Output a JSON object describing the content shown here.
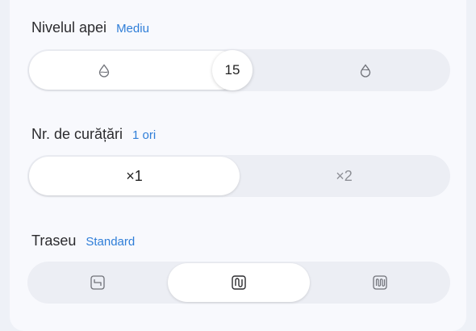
{
  "water_level": {
    "title": "Nivelul apei",
    "value": "Mediu",
    "slider_value": "15",
    "min_icon": "small-water-drop-icon",
    "max_icon": "large-water-drop-icon"
  },
  "cleaning_count": {
    "title": "Nr. de curățări",
    "value": "1 ori",
    "options": [
      "×1",
      "×2"
    ],
    "selected_index": 0
  },
  "route": {
    "title": "Traseu",
    "value": "Standard",
    "options": [
      "quick-route-icon",
      "standard-route-icon",
      "deep-route-icon"
    ],
    "selected_index": 1
  },
  "colors": {
    "accent": "#2f7ed8",
    "text": "#2b2b2e",
    "muted": "#8d8f96",
    "track": "#eceef4"
  }
}
